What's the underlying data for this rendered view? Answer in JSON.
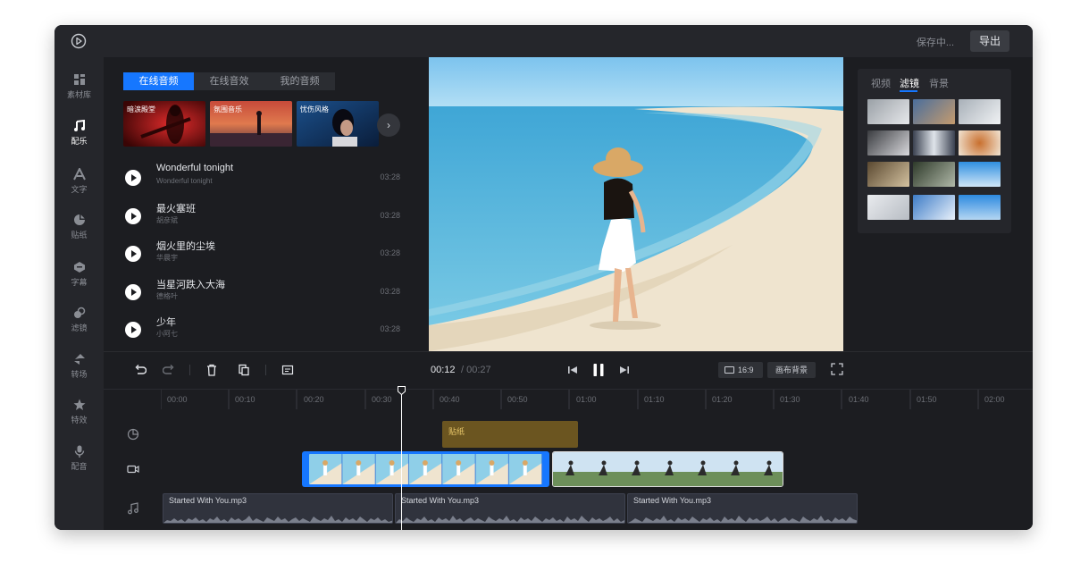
{
  "topbar": {
    "status": "保存中...",
    "export_label": "导出"
  },
  "sidebar": {
    "items": [
      {
        "label": "素材库",
        "icon": "library-icon"
      },
      {
        "label": "配乐",
        "icon": "music-note-icon",
        "active": true
      },
      {
        "label": "文字",
        "icon": "text-icon"
      },
      {
        "label": "贴纸",
        "icon": "sticker-icon"
      },
      {
        "label": "字幕",
        "icon": "subtitle-icon"
      },
      {
        "label": "滤镜",
        "icon": "filter-icon"
      },
      {
        "label": "转场",
        "icon": "transition-icon"
      },
      {
        "label": "特效",
        "icon": "effects-icon"
      },
      {
        "label": "配音",
        "icon": "microphone-icon"
      }
    ]
  },
  "music": {
    "tabs": [
      "在线音频",
      "在线音效",
      "我的音频"
    ],
    "active_tab": "在线音频",
    "covers": [
      {
        "label": "暗涙殿堂"
      },
      {
        "label": "氛围音乐"
      },
      {
        "label": "忧伤风格"
      }
    ],
    "tracks": [
      {
        "title": "Wonderful tonight",
        "artist": "Wonderful tonight",
        "duration": "03:28"
      },
      {
        "title": "最火塞班",
        "artist": "胡彦斌",
        "duration": "03:28"
      },
      {
        "title": "烟火里的尘埃",
        "artist": "华晨宇",
        "duration": "03:28"
      },
      {
        "title": "当星河跌入大海",
        "artist": "德格叶",
        "duration": "03:28"
      },
      {
        "title": "少年",
        "artist": "小阿七",
        "duration": "03:28"
      }
    ]
  },
  "filters": {
    "tabs": [
      "视频",
      "滤镜",
      "背景"
    ],
    "active_tab": "滤镜"
  },
  "toolbar": {
    "current_time": "00:12",
    "total_time": "/ 00:27",
    "ratio_label": "16:9",
    "canvas_label": "画布背景"
  },
  "timeline": {
    "ticks": [
      "00:00",
      "00:10",
      "00:20",
      "00:30",
      "00:40",
      "00:50",
      "01:00",
      "01:10",
      "01:20",
      "01:30",
      "01:40",
      "01:50",
      "02:00"
    ],
    "sticker_label": "贴纸",
    "audio_clips": [
      "Started With You.mp3",
      "Started With You.mp3",
      "Started With You.mp3"
    ]
  },
  "colors": {
    "accent": "#1677ff",
    "sticker": "#6b5520",
    "background": "#1c1d21",
    "panel": "#25262b"
  }
}
